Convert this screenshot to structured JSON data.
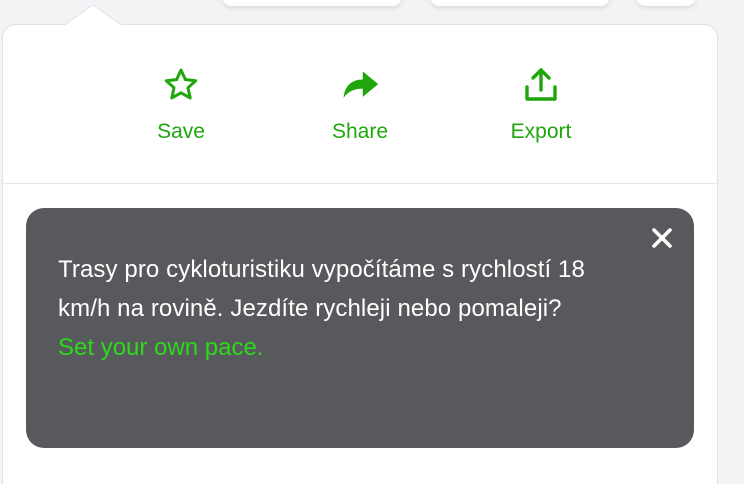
{
  "actions": {
    "save_label": "Save",
    "share_label": "Share",
    "export_label": "Export",
    "accent_color": "#1ea60b"
  },
  "tooltip": {
    "message": "Trasy pro cykloturistiku vypočítáme s rychlostí 18 km/h na rovině. Jezdíte rychleji nebo pomaleji?",
    "link_text": "Set your own pace.",
    "link_color": "#2ed81b",
    "background_color": "#58595c",
    "close_icon": "close-icon"
  },
  "icons": {
    "save": "star-icon",
    "share": "share-arrow-icon",
    "export": "upload-icon"
  }
}
